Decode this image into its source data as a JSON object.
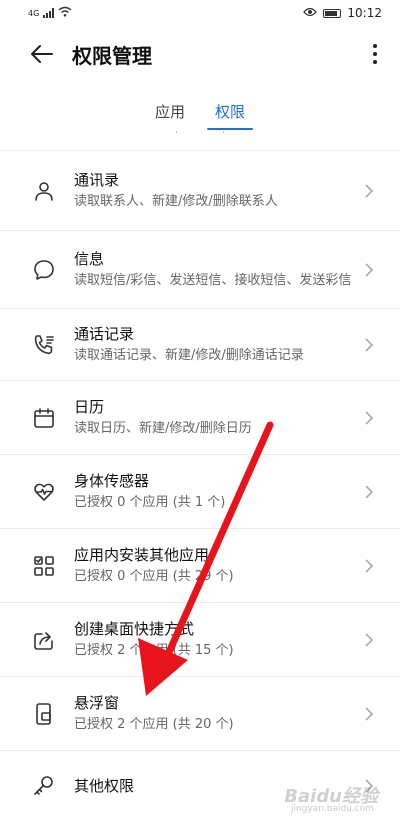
{
  "status_bar": {
    "network": "4G",
    "time": "10:12"
  },
  "header": {
    "title": "权限管理"
  },
  "tabs": [
    {
      "label": "应用"
    },
    {
      "label": "权限"
    }
  ],
  "tab_indicator_text": ". .",
  "permissions": [
    {
      "title": "通讯录",
      "subtitle": "读取联系人、新建/修改/删除联系人",
      "icon": "contact-icon"
    },
    {
      "title": "信息",
      "subtitle": "读取短信/彩信、发送短信、接收短信、发送彩信",
      "icon": "message-icon"
    },
    {
      "title": "通话记录",
      "subtitle": "读取通话记录、新建/修改/删除通话记录",
      "icon": "call-log-icon"
    },
    {
      "title": "日历",
      "subtitle": "读取日历、新建/修改/删除日历",
      "icon": "calendar-icon"
    },
    {
      "title": "身体传感器",
      "subtitle": "已授权 0 个应用 (共 1 个)",
      "icon": "heart-icon"
    },
    {
      "title": "应用内安装其他应用",
      "subtitle": "已授权 0 个应用 (共 29 个)",
      "icon": "app-grid-icon"
    },
    {
      "title": "创建桌面快捷方式",
      "subtitle": "已授权 2 个应用 (共 15 个)",
      "icon": "shortcut-icon"
    },
    {
      "title": "悬浮窗",
      "subtitle": "已授权 2 个应用 (共 20 个)",
      "icon": "floating-window-icon"
    },
    {
      "title": "其他权限",
      "subtitle": "",
      "icon": "key-icon"
    }
  ],
  "watermark": {
    "text": "Baidu经验",
    "sub": "jingyan.baidu.com"
  },
  "colors": {
    "accent": "#1e6fd9",
    "annotation_arrow": "#e8141c"
  }
}
